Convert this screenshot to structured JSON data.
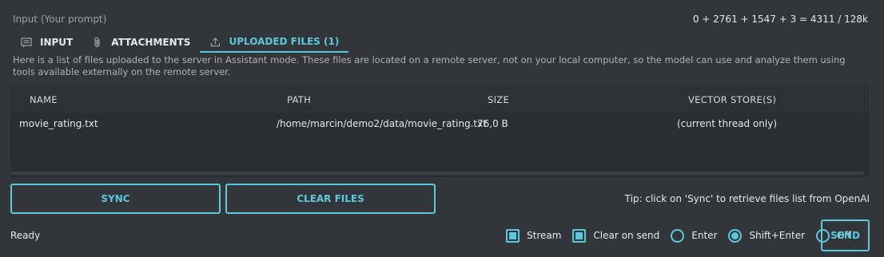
{
  "prompt_label": "Input (Your prompt)",
  "token_count": "0 + 2761 + 1547 + 3 = 4311 / 128k",
  "tabs": [
    {
      "label": "INPUT",
      "icon": "chat-icon",
      "active": false
    },
    {
      "label": "ATTACHMENTS",
      "icon": "paperclip-icon",
      "active": false
    },
    {
      "label": "UPLOADED FILES (1)",
      "icon": "upload-icon",
      "active": true
    }
  ],
  "description": "Here is a list of files uploaded to the server in Assistant mode. These files are located on a remote server, not on your local computer, so the model can use and analyze them using tools available externally on the remote server.",
  "table": {
    "headers": [
      "NAME",
      "PATH",
      "SIZE",
      "VECTOR STORE(S)"
    ],
    "rows": [
      [
        "movie_rating.txt",
        "/home/marcin/demo2/data/movie_rating.txt",
        "76,0 B",
        "(current thread only)"
      ]
    ]
  },
  "buttons": {
    "sync": "SYNC",
    "clear_files": "CLEAR FILES",
    "send": "SEND"
  },
  "tip": "Tip: click on 'Sync' to retrieve files list from OpenAI",
  "status": "Ready",
  "options": {
    "stream": {
      "label": "Stream",
      "checked": true
    },
    "clear_on_send": {
      "label": "Clear on send",
      "checked": true
    },
    "enter": {
      "label": "Enter",
      "selected": false
    },
    "shift_enter": {
      "label": "Shift+Enter",
      "selected": true
    },
    "off": {
      "label": "Off",
      "selected": false
    }
  },
  "colors": {
    "background": "#32363b",
    "accent": "#5bc8dc",
    "table_bg": "#2a2d31"
  }
}
